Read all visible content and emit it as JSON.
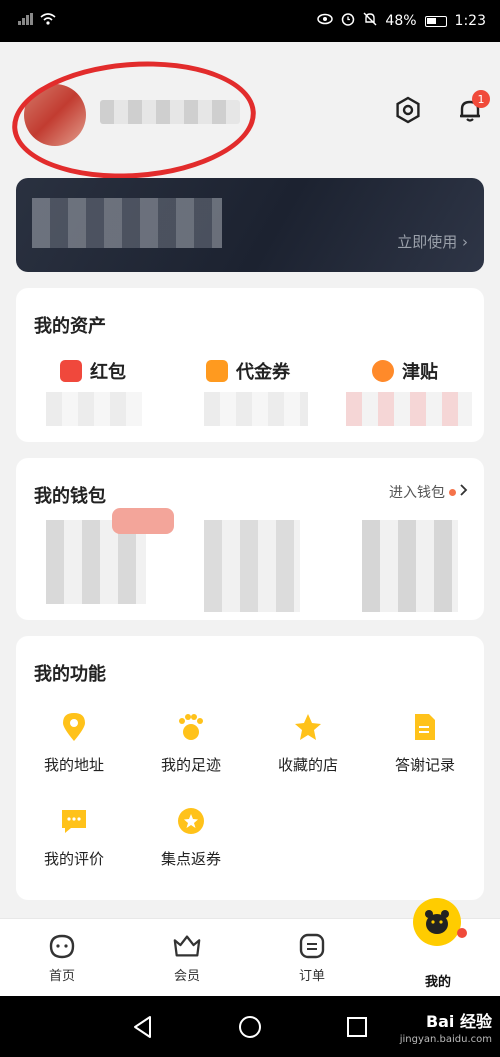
{
  "status": {
    "battery": "48%",
    "time": "1:23"
  },
  "header": {
    "notification_count": "1"
  },
  "banner": {
    "cta": "立即使用 ›"
  },
  "assets": {
    "title": "我的资产",
    "items": [
      {
        "label": "红包"
      },
      {
        "label": "代金券"
      },
      {
        "label": "津贴"
      }
    ]
  },
  "wallet": {
    "title": "我的钱包",
    "link": "进入钱包"
  },
  "functions": {
    "title": "我的功能",
    "items": [
      {
        "label": "我的地址"
      },
      {
        "label": "我的足迹"
      },
      {
        "label": "收藏的店"
      },
      {
        "label": "答谢记录"
      },
      {
        "label": "我的评价"
      },
      {
        "label": "集点返券"
      }
    ]
  },
  "tabbar": {
    "items": [
      {
        "label": "首页"
      },
      {
        "label": "会员"
      },
      {
        "label": "订单"
      },
      {
        "label": "我的"
      }
    ]
  },
  "watermark": {
    "brand": "Bai 经验",
    "url": "jingyan.baidu.com"
  },
  "colors": {
    "accent": "#ffcc00",
    "badge": "#f04a3a",
    "annotation": "#e22c2c"
  }
}
